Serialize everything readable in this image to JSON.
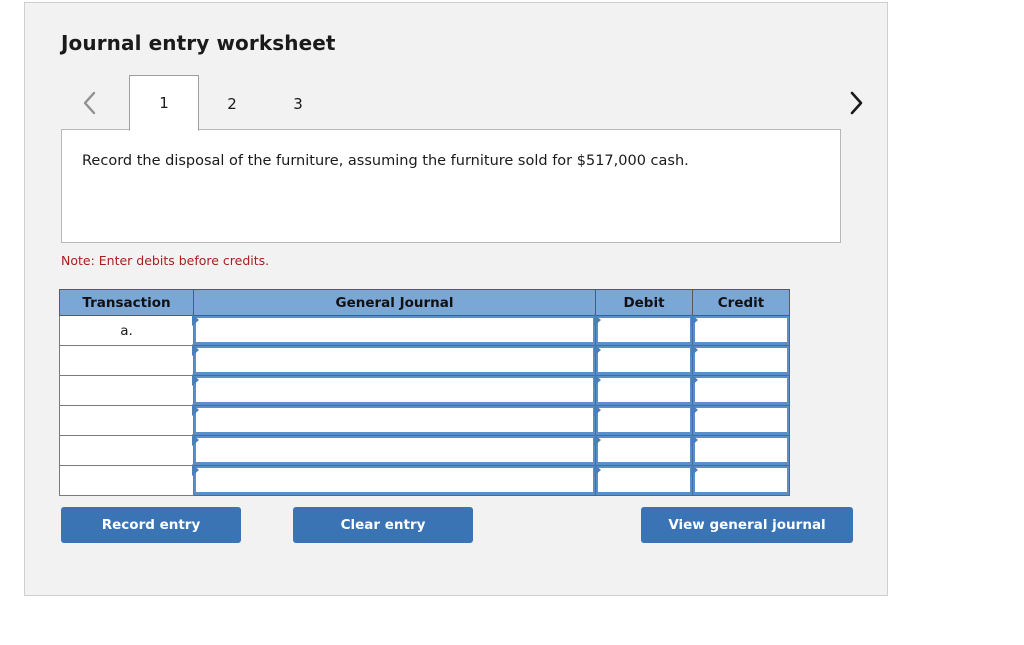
{
  "worksheet": {
    "title": "Journal entry worksheet",
    "nav": {
      "prev_icon": "chevron-left-icon",
      "next_icon": "chevron-right-icon",
      "prev_enabled": false,
      "next_enabled": true
    },
    "tabs": [
      {
        "label": "1",
        "active": true
      },
      {
        "label": "2",
        "active": false
      },
      {
        "label": "3",
        "active": false
      }
    ],
    "instruction": "Record the disposal of the furniture, assuming the furniture sold for $517,000 cash.",
    "note": "Note: Enter debits before credits."
  },
  "table": {
    "headers": {
      "transaction": "Transaction",
      "general_journal": "General Journal",
      "debit": "Debit",
      "credit": "Credit"
    },
    "rows": [
      {
        "transaction": "a.",
        "general_journal": "",
        "debit": "",
        "credit": ""
      },
      {
        "transaction": "",
        "general_journal": "",
        "debit": "",
        "credit": ""
      },
      {
        "transaction": "",
        "general_journal": "",
        "debit": "",
        "credit": ""
      },
      {
        "transaction": "",
        "general_journal": "",
        "debit": "",
        "credit": ""
      },
      {
        "transaction": "",
        "general_journal": "",
        "debit": "",
        "credit": ""
      },
      {
        "transaction": "",
        "general_journal": "",
        "debit": "",
        "credit": ""
      }
    ]
  },
  "buttons": {
    "record_entry": "Record entry",
    "clear_entry": "Clear entry",
    "view_general_journal": "View general journal"
  },
  "colors": {
    "panel_background": "#f2f2f2",
    "header_blue": "#7ba7d7",
    "cell_blue": "#5b8fc9",
    "button_blue": "#3b74b4",
    "note_red": "#a72020",
    "page_background": "#ffffff"
  }
}
